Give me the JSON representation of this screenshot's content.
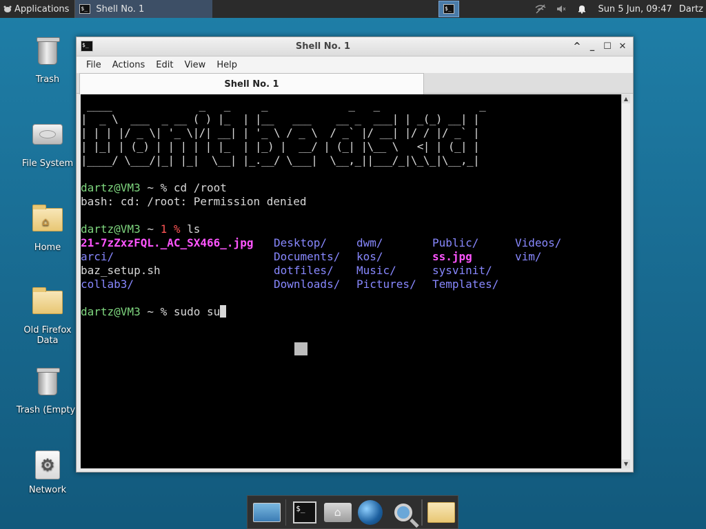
{
  "top_panel": {
    "applications_label": "Applications",
    "task_title": "Shell No. 1",
    "clock": "Sun  5 Jun, 09:47",
    "user": "Dartz"
  },
  "desktop_icons": [
    {
      "label": "Trash"
    },
    {
      "label": "File System"
    },
    {
      "label": "Home"
    },
    {
      "label": "Old Firefox Data"
    },
    {
      "label": "Trash (Empty)"
    },
    {
      "label": "Network"
    }
  ],
  "window": {
    "title": "Shell No. 1",
    "menu": [
      "File",
      "Actions",
      "Edit",
      "View",
      "Help"
    ],
    "tab_label": "Shell No. 1"
  },
  "terminal": {
    "ascii_art": [
      " ____              _   _     _             _   _                _ ",
      "|  _ \\  ___  _ __ ( ) |_  | |__   ___    __ _  ___| | _(_) __| |",
      "| | | |/ _ \\| '_ \\|/| __| | '_ \\ / _ \\  / _` |/ __| |/ / |/ _` |",
      "| |_| | (_) | | | | | |_  | |_) |  __/ | (_| |\\__ \\   <| | (_| |",
      "|____/ \\___/|_| |_|  \\__| |_.__/ \\___|  \\__,_||___/_|\\_\\_|\\__,_|"
    ],
    "prompt_user": "dartz",
    "prompt_host": "@VM3",
    "prompt_tilde": " ~ ",
    "prompt_symbol": "% ",
    "cmd1": "cd /root",
    "error1": "bash: cd: /root: Permission denied",
    "exit_code": "1",
    "cmd2": "ls",
    "ls": {
      "f1": "21-7zZxzFQL._AC_SX466_.jpg",
      "f2": "arci/",
      "f3": "baz_setup.sh",
      "f4": "collab3/",
      "f5": "Desktop/",
      "f6": "Documents/",
      "f7": "dotfiles/",
      "f8": "Downloads/",
      "f9": "dwm/",
      "f10": "kos/",
      "f11": "Music/",
      "f12": "Pictures/",
      "f13": "Public/",
      "f14": "ss.jpg",
      "f15": "sysvinit/",
      "f16": "Templates/",
      "f17": "Videos/",
      "f18": "vim/"
    },
    "cmd3": "sudo su"
  },
  "colors": {
    "prompt": "#7fd77f",
    "error_code": "#ff5555",
    "directory": "#8888ff",
    "image": "#ff55ff"
  }
}
